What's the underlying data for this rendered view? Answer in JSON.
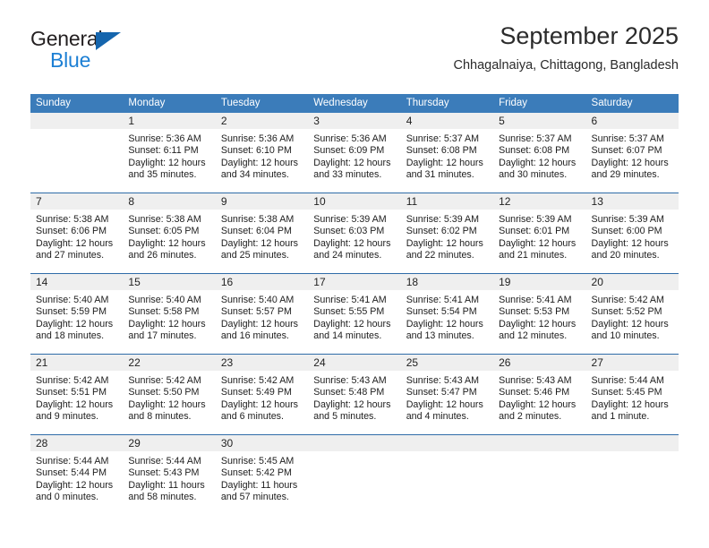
{
  "brand": {
    "name_part1": "General",
    "name_part2": "Blue",
    "logo_icon": "triangle-logo-icon",
    "accent_color": "#1c7fd4",
    "triangle_color": "#1565ad"
  },
  "header": {
    "title": "September 2025",
    "subtitle": "Chhagalnaiya, Chittagong, Bangladesh"
  },
  "calendar": {
    "header_bg": "#3b7cba",
    "header_text_color": "#ffffff",
    "row_divider_color": "#2f6ca8",
    "day_band_bg": "#efefef",
    "weekdays": [
      "Sunday",
      "Monday",
      "Tuesday",
      "Wednesday",
      "Thursday",
      "Friday",
      "Saturday"
    ],
    "weeks": [
      [
        {
          "day": "",
          "lines": []
        },
        {
          "day": "1",
          "lines": [
            "Sunrise: 5:36 AM",
            "Sunset: 6:11 PM",
            "Daylight: 12 hours",
            "and 35 minutes."
          ]
        },
        {
          "day": "2",
          "lines": [
            "Sunrise: 5:36 AM",
            "Sunset: 6:10 PM",
            "Daylight: 12 hours",
            "and 34 minutes."
          ]
        },
        {
          "day": "3",
          "lines": [
            "Sunrise: 5:36 AM",
            "Sunset: 6:09 PM",
            "Daylight: 12 hours",
            "and 33 minutes."
          ]
        },
        {
          "day": "4",
          "lines": [
            "Sunrise: 5:37 AM",
            "Sunset: 6:08 PM",
            "Daylight: 12 hours",
            "and 31 minutes."
          ]
        },
        {
          "day": "5",
          "lines": [
            "Sunrise: 5:37 AM",
            "Sunset: 6:08 PM",
            "Daylight: 12 hours",
            "and 30 minutes."
          ]
        },
        {
          "day": "6",
          "lines": [
            "Sunrise: 5:37 AM",
            "Sunset: 6:07 PM",
            "Daylight: 12 hours",
            "and 29 minutes."
          ]
        }
      ],
      [
        {
          "day": "7",
          "lines": [
            "Sunrise: 5:38 AM",
            "Sunset: 6:06 PM",
            "Daylight: 12 hours",
            "and 27 minutes."
          ]
        },
        {
          "day": "8",
          "lines": [
            "Sunrise: 5:38 AM",
            "Sunset: 6:05 PM",
            "Daylight: 12 hours",
            "and 26 minutes."
          ]
        },
        {
          "day": "9",
          "lines": [
            "Sunrise: 5:38 AM",
            "Sunset: 6:04 PM",
            "Daylight: 12 hours",
            "and 25 minutes."
          ]
        },
        {
          "day": "10",
          "lines": [
            "Sunrise: 5:39 AM",
            "Sunset: 6:03 PM",
            "Daylight: 12 hours",
            "and 24 minutes."
          ]
        },
        {
          "day": "11",
          "lines": [
            "Sunrise: 5:39 AM",
            "Sunset: 6:02 PM",
            "Daylight: 12 hours",
            "and 22 minutes."
          ]
        },
        {
          "day": "12",
          "lines": [
            "Sunrise: 5:39 AM",
            "Sunset: 6:01 PM",
            "Daylight: 12 hours",
            "and 21 minutes."
          ]
        },
        {
          "day": "13",
          "lines": [
            "Sunrise: 5:39 AM",
            "Sunset: 6:00 PM",
            "Daylight: 12 hours",
            "and 20 minutes."
          ]
        }
      ],
      [
        {
          "day": "14",
          "lines": [
            "Sunrise: 5:40 AM",
            "Sunset: 5:59 PM",
            "Daylight: 12 hours",
            "and 18 minutes."
          ]
        },
        {
          "day": "15",
          "lines": [
            "Sunrise: 5:40 AM",
            "Sunset: 5:58 PM",
            "Daylight: 12 hours",
            "and 17 minutes."
          ]
        },
        {
          "day": "16",
          "lines": [
            "Sunrise: 5:40 AM",
            "Sunset: 5:57 PM",
            "Daylight: 12 hours",
            "and 16 minutes."
          ]
        },
        {
          "day": "17",
          "lines": [
            "Sunrise: 5:41 AM",
            "Sunset: 5:55 PM",
            "Daylight: 12 hours",
            "and 14 minutes."
          ]
        },
        {
          "day": "18",
          "lines": [
            "Sunrise: 5:41 AM",
            "Sunset: 5:54 PM",
            "Daylight: 12 hours",
            "and 13 minutes."
          ]
        },
        {
          "day": "19",
          "lines": [
            "Sunrise: 5:41 AM",
            "Sunset: 5:53 PM",
            "Daylight: 12 hours",
            "and 12 minutes."
          ]
        },
        {
          "day": "20",
          "lines": [
            "Sunrise: 5:42 AM",
            "Sunset: 5:52 PM",
            "Daylight: 12 hours",
            "and 10 minutes."
          ]
        }
      ],
      [
        {
          "day": "21",
          "lines": [
            "Sunrise: 5:42 AM",
            "Sunset: 5:51 PM",
            "Daylight: 12 hours",
            "and 9 minutes."
          ]
        },
        {
          "day": "22",
          "lines": [
            "Sunrise: 5:42 AM",
            "Sunset: 5:50 PM",
            "Daylight: 12 hours",
            "and 8 minutes."
          ]
        },
        {
          "day": "23",
          "lines": [
            "Sunrise: 5:42 AM",
            "Sunset: 5:49 PM",
            "Daylight: 12 hours",
            "and 6 minutes."
          ]
        },
        {
          "day": "24",
          "lines": [
            "Sunrise: 5:43 AM",
            "Sunset: 5:48 PM",
            "Daylight: 12 hours",
            "and 5 minutes."
          ]
        },
        {
          "day": "25",
          "lines": [
            "Sunrise: 5:43 AM",
            "Sunset: 5:47 PM",
            "Daylight: 12 hours",
            "and 4 minutes."
          ]
        },
        {
          "day": "26",
          "lines": [
            "Sunrise: 5:43 AM",
            "Sunset: 5:46 PM",
            "Daylight: 12 hours",
            "and 2 minutes."
          ]
        },
        {
          "day": "27",
          "lines": [
            "Sunrise: 5:44 AM",
            "Sunset: 5:45 PM",
            "Daylight: 12 hours",
            "and 1 minute."
          ]
        }
      ],
      [
        {
          "day": "28",
          "lines": [
            "Sunrise: 5:44 AM",
            "Sunset: 5:44 PM",
            "Daylight: 12 hours",
            "and 0 minutes."
          ]
        },
        {
          "day": "29",
          "lines": [
            "Sunrise: 5:44 AM",
            "Sunset: 5:43 PM",
            "Daylight: 11 hours",
            "and 58 minutes."
          ]
        },
        {
          "day": "30",
          "lines": [
            "Sunrise: 5:45 AM",
            "Sunset: 5:42 PM",
            "Daylight: 11 hours",
            "and 57 minutes."
          ]
        },
        {
          "day": "",
          "lines": []
        },
        {
          "day": "",
          "lines": []
        },
        {
          "day": "",
          "lines": []
        },
        {
          "day": "",
          "lines": []
        }
      ]
    ]
  }
}
